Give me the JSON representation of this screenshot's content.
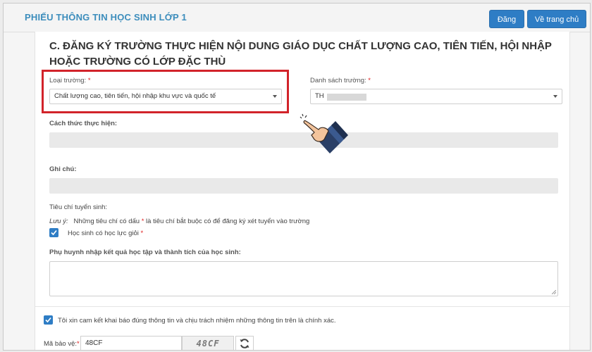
{
  "header": {
    "title": "PHIẾU THÔNG TIN HỌC SINH LỚP 1",
    "register_label": "Đăng ký",
    "home_label": "Về trang chủ"
  },
  "section": {
    "title": "C. ĐĂNG KÝ TRƯỜNG THỰC HIỆN NỘI DUNG GIÁO DỤC CHẤT LƯỢNG CAO, TIÊN TIẾN, HỘI NHẬP HOẶC TRƯỜNG CÓ LỚP ĐẶC THÙ"
  },
  "school_type": {
    "label": "Loại trường:",
    "required_mark": "*",
    "value": "Chất lượng cao, tiên tiến, hội nhập khu vực và quốc tế"
  },
  "school_list": {
    "label": "Danh sách trường:",
    "required_mark": "*",
    "value": "TH"
  },
  "method": {
    "label": "Cách thức thực hiện:"
  },
  "note": {
    "label": "Ghi chú:"
  },
  "criteria": {
    "label": "Tiêu chí tuyển sinh:",
    "note_prefix": "Lưu ý:",
    "note_text_1": "Những tiêu chí có dấu",
    "note_mark": "*",
    "note_text_2": "là tiêu chí bắt buộc có để đăng ký xét tuyển vào trường",
    "checkbox_label": "Học sinh có học lực giỏi",
    "checkbox_mark": "*",
    "checked": true
  },
  "parent_input": {
    "label": "Phụ huynh nhập kết quả học tập và thành tích của học sinh:",
    "value": ""
  },
  "commitment": {
    "text": "Tôi xin cam kết khai báo đúng thông tin và chịu trách nhiệm những thông tin trên là chính xác.",
    "checked": true
  },
  "captcha": {
    "label": "Mã bảo vệ:",
    "required_mark": "*",
    "input_value": "48CF",
    "image_text": "48CF"
  },
  "colors": {
    "accent": "#2e7dc5",
    "title_blue": "#3c8dbc",
    "highlight_red": "#d2232a"
  }
}
